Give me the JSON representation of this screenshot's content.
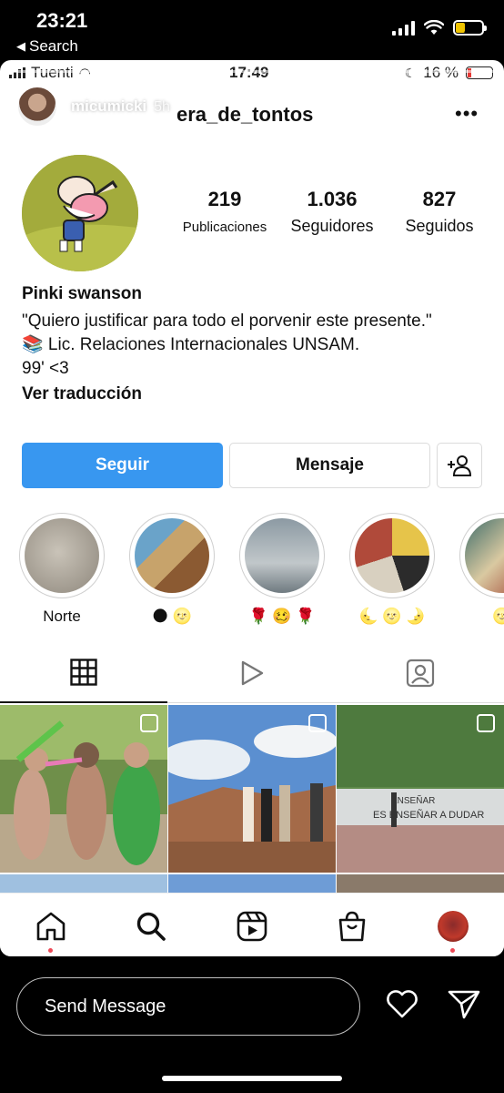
{
  "os_status": {
    "time": "23:21",
    "back_label": "Search",
    "icons": [
      "signal-icon",
      "wifi-icon",
      "battery-charging-icon"
    ]
  },
  "inner_status": {
    "carrier": "Tuenti",
    "time": "17:49",
    "battery": "16 %",
    "battery_level": 0.16
  },
  "story": {
    "username": "micumicki",
    "time_ago": "5h",
    "menu": "•••"
  },
  "profile": {
    "username": "era_de_tontos",
    "more": "•••",
    "stats": [
      {
        "value": "219",
        "label": "Publicaciones"
      },
      {
        "value": "1.036",
        "label": "Seguidores"
      },
      {
        "value": "827",
        "label": "Seguidos"
      }
    ],
    "bio": {
      "name": "Pinki swanson",
      "line1": "\"Quiero justificar para todo el porvenir este presente.\"",
      "line2": "📚 Lic. Relaciones Internacionales UNSAM.",
      "line3": "99' <3",
      "translate": "Ver traducción"
    },
    "buttons": {
      "follow": "Seguir",
      "message": "Mensaje"
    },
    "highlights": [
      {
        "caption": "Norte"
      },
      {
        "caption": "🌑 🌝"
      },
      {
        "caption": "🌹 🥴 🌹"
      },
      {
        "caption": "🌜 🌝 🌛"
      },
      {
        "caption": "🌝"
      }
    ]
  },
  "reply": {
    "placeholder": "Send Message"
  },
  "colors": {
    "follow_button": "#3897f0",
    "notification_dot": "#ed4956",
    "status_battery": "#f0c400"
  }
}
